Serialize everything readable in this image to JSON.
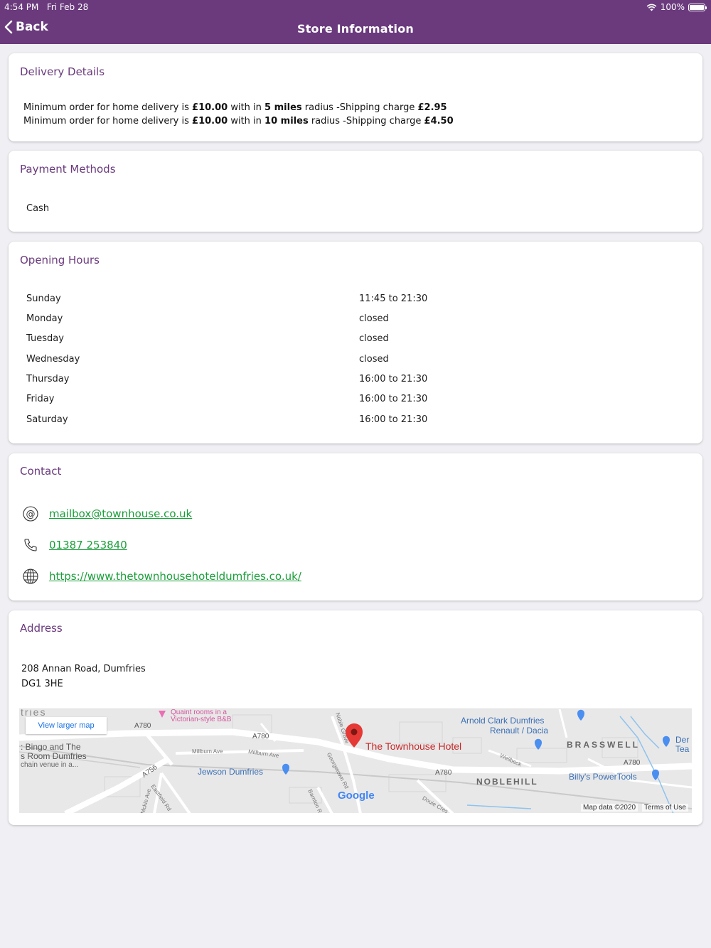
{
  "status_bar": {
    "time": "4:54 PM",
    "date": "Fri Feb 28",
    "battery": "100%",
    "battery_level": 1.0
  },
  "nav": {
    "back_label": "Back",
    "title": "Store Information"
  },
  "delivery": {
    "title": "Delivery Details",
    "lines": [
      {
        "prefix": "Minimum order for home delivery is ",
        "amount": "£10.00",
        "mid": " with in ",
        "radius": "5 miles",
        "suffix": " radius -Shipping charge ",
        "charge": "£2.95"
      },
      {
        "prefix": "Minimum order for home delivery is ",
        "amount": "£10.00",
        "mid": " with in ",
        "radius": "10 miles",
        "suffix": " radius -Shipping charge ",
        "charge": "£4.50"
      }
    ]
  },
  "payment": {
    "title": "Payment Methods",
    "methods": [
      "Cash"
    ]
  },
  "hours": {
    "title": "Opening Hours",
    "rows": [
      {
        "day": "Sunday",
        "time": "11:45 to 21:30"
      },
      {
        "day": "Monday",
        "time": "closed"
      },
      {
        "day": "Tuesday",
        "time": "closed"
      },
      {
        "day": "Wednesday",
        "time": "closed"
      },
      {
        "day": "Thursday",
        "time": "16:00 to 21:30"
      },
      {
        "day": "Friday",
        "time": "16:00 to 21:30"
      },
      {
        "day": "Saturday",
        "time": "16:00 to 21:30"
      }
    ]
  },
  "contact": {
    "title": "Contact",
    "email": "mailbox@townhouse.co.uk",
    "phone": "01387 253840",
    "website": "https://www.thetownhousehoteldumfries.co.uk/"
  },
  "address": {
    "title": "Address",
    "line1": "208 Annan Road, Dumfries",
    "line2": "DG1 3HE"
  },
  "map": {
    "view_larger": "View larger map",
    "place_name": "The Townhouse Hotel",
    "attribution": "Map data ©2020",
    "terms": "Terms of Use",
    "logo": "Google",
    "labels": {
      "tries": "tries",
      "quaint1": "Quaint rooms in a",
      "quaint2": "Victorian-style B&B",
      "bingo1": ": Bingo and The",
      "bingo2": "s Room Dumfries",
      "bingo3": "chain venue in a...",
      "a780_1": "A780",
      "a780_2": "A780",
      "a780_3": "A780",
      "a780_4": "A780",
      "a756": "A756",
      "millburn1": "Millburn Ave",
      "millburn2": "Millburn Ave",
      "jewson": "Jewson Dumfries",
      "arnold1": "Arnold Clark Dumfries",
      "arnold2": "Renault / Dacia",
      "brasswell": "BRASSWELL",
      "noblehill": "NOBLEHILL",
      "billys": "Billy's PowerTools",
      "der1": "Der",
      "der2": "Tea",
      "noble_grove": "Noble Grove",
      "georgetown": "Georgetown Rd",
      "eastfield": "Eastfield Rd",
      "mckie": "Mckie Ave",
      "barnton": "Barnton R",
      "douie": "Douie Cres",
      "wellbeck": "Wellbeck"
    }
  },
  "colors": {
    "header": "#6a3a7d",
    "link": "#1a9e3a",
    "background": "#efeff4",
    "pin": "#e53935"
  }
}
